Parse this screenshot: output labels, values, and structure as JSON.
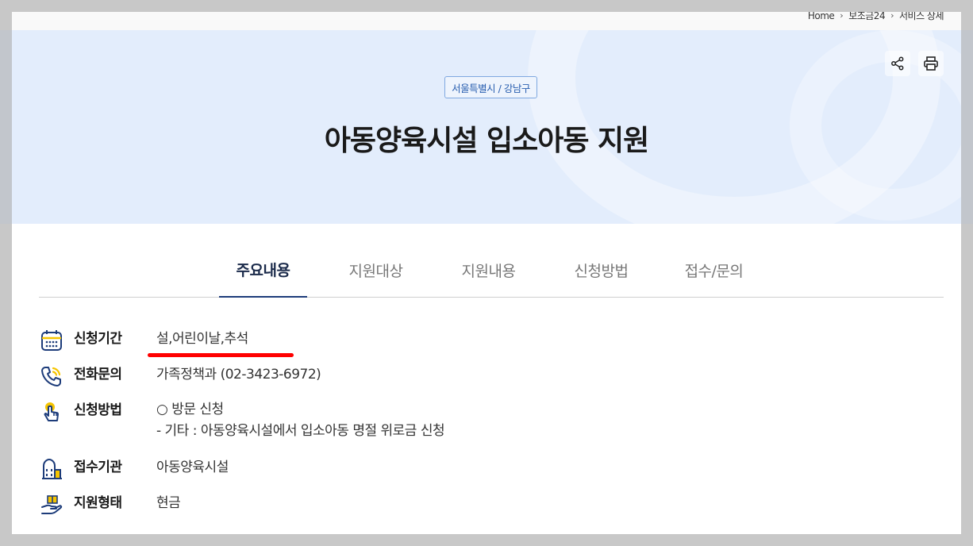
{
  "breadcrumb": {
    "items": [
      "Home",
      "보조금24",
      "서비스 상세"
    ]
  },
  "hero": {
    "region_tag": "서울특별시 / 강남구",
    "title": "아동양육시설 입소아동 지원",
    "share_icon": "share-icon",
    "print_icon": "print-icon"
  },
  "tabs": [
    {
      "label": "주요내용",
      "active": true
    },
    {
      "label": "지원대상",
      "active": false
    },
    {
      "label": "지원내용",
      "active": false
    },
    {
      "label": "신청방법",
      "active": false
    },
    {
      "label": "접수/문의",
      "active": false
    }
  ],
  "info": [
    {
      "icon": "calendar-icon",
      "label": "신청기간",
      "value": "설,어린이날,추석"
    },
    {
      "icon": "phone-icon",
      "label": "전화문의",
      "value": "가족정책과 (02-3423-6972)"
    },
    {
      "icon": "hand-pointer-icon",
      "label": "신청방법",
      "value": "○ 방문 신청",
      "value2": "- 기타 : 아동양육시설에서 입소아동 명절 위로금 신청"
    },
    {
      "icon": "building-icon",
      "label": "접수기관",
      "value": "아동양육시설"
    },
    {
      "icon": "hand-gift-icon",
      "label": "지원형태",
      "value": "현금"
    }
  ],
  "colors": {
    "hero_bg": "#e3edfc",
    "accent": "#1d3c7a",
    "icon_yellow": "#f5c400",
    "icon_navy": "#1d3c7a",
    "annotation": "#ff0000"
  }
}
